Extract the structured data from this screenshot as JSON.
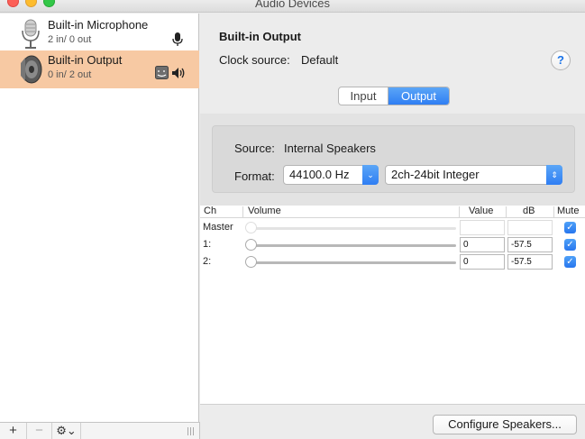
{
  "window": {
    "title": "Audio Devices"
  },
  "sidebar": {
    "devices": [
      {
        "name": "Built-in Microphone",
        "io": "2 in/ 0 out",
        "icon": "microphone-icon",
        "selected": false
      },
      {
        "name": "Built-in Output",
        "io": "0 in/ 2 out",
        "icon": "speaker-icon",
        "selected": true
      }
    ],
    "toolbar": {
      "add": "+",
      "remove": "−",
      "gear": "⚙⌄"
    }
  },
  "main": {
    "device_title": "Built-in Output",
    "clock_label": "Clock source:",
    "clock_value": "Default",
    "help": "?",
    "tabs": [
      {
        "label": "Input",
        "selected": false
      },
      {
        "label": "Output",
        "selected": true
      }
    ],
    "source_label": "Source:",
    "source_value": "Internal Speakers",
    "format_label": "Format:",
    "sample_rate": "44100.0 Hz",
    "bit_format": "2ch-24bit Integer",
    "table": {
      "headers": {
        "ch": "Ch",
        "volume": "Volume",
        "value": "Value",
        "db": "dB",
        "mute": "Mute"
      },
      "rows": [
        {
          "ch": "Master",
          "value": "",
          "db": "",
          "enabled": false,
          "mute": true
        },
        {
          "ch": "1:",
          "value": "0",
          "db": "-57.5",
          "enabled": true,
          "mute": true
        },
        {
          "ch": "2:",
          "value": "0",
          "db": "-57.5",
          "enabled": true,
          "mute": true
        }
      ]
    },
    "configure_button": "Configure Speakers..."
  },
  "colors": {
    "selection": "#f7c9a3",
    "accent": "#2f7ef3"
  }
}
